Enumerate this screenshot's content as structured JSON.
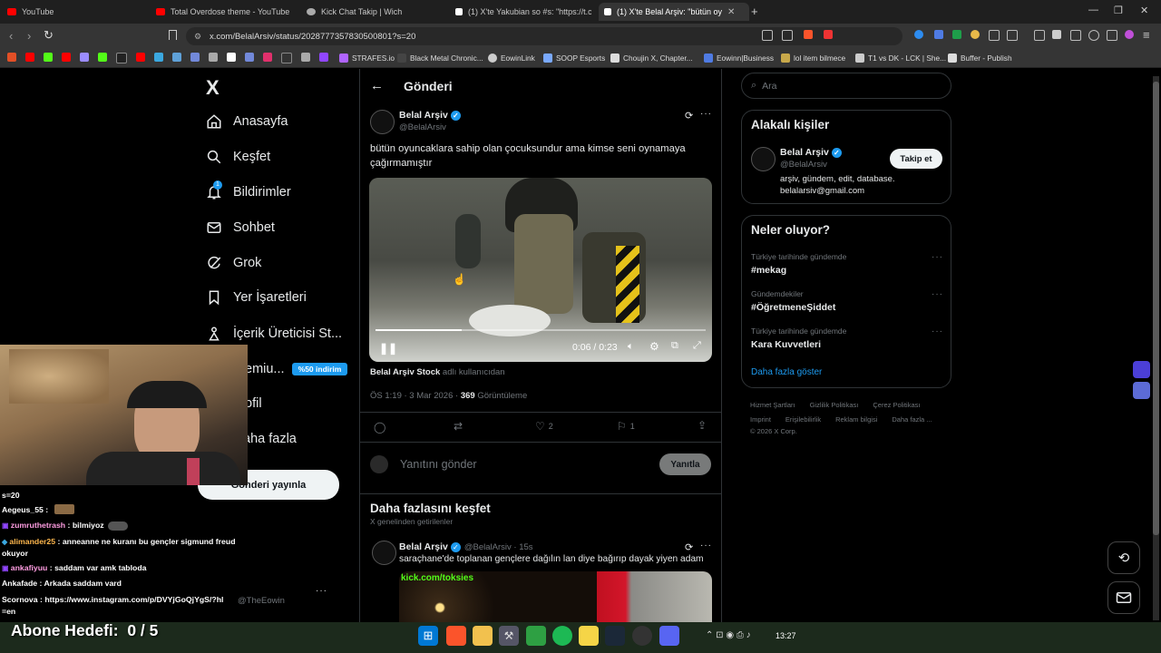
{
  "browser": {
    "tabs": [
      {
        "label": "YouTube",
        "color": "#ff0000"
      },
      {
        "label": "Total Overdose theme - YouTube",
        "color": "#ff0000"
      },
      {
        "label": "Kick Chat Takip | Wich",
        "color": "#aaaaaa"
      },
      {
        "label": "(1) X'te Yakubian so #s: \"https://t.co/",
        "color": "#ffffff"
      },
      {
        "label": "(1) X'te Belal Arşiv: \"bütün oy",
        "color": "#ffffff"
      }
    ],
    "url": "x.com/BelalArsiv/status/2028777357830500801?s=20",
    "bookmarks": [
      "STRAFES.io",
      "Black Metal Chronic...",
      "EowinLink",
      "SOOP Esports",
      "Choujin X, Chapter...",
      "Eowinn|Business",
      "lol item bilmece",
      "T1 vs DK - LCK | She...",
      "Buffer - Publish"
    ]
  },
  "sidebar": {
    "logo": "X",
    "items": [
      {
        "label": "Anasayfa",
        "icon": "home-icon"
      },
      {
        "label": "Keşfet",
        "icon": "search-icon"
      },
      {
        "label": "Bildirimler",
        "icon": "bell-icon",
        "badge": "1"
      },
      {
        "label": "Sohbet",
        "icon": "mail-icon"
      },
      {
        "label": "Grok",
        "icon": "grok-icon"
      },
      {
        "label": "Yer İşaretleri",
        "icon": "bookmark-icon"
      },
      {
        "label": "İçerik Üreticisi St...",
        "icon": "creator-icon"
      },
      {
        "label": "emiu...",
        "icon": "premium-icon"
      },
      {
        "label": "ofil",
        "icon": "profile-icon"
      },
      {
        "label": "aha fazla",
        "icon": "more-icon"
      }
    ],
    "premium_badge": "%50 indirim",
    "post_button": "Gönderi yayınla",
    "account_handle": "@TheEowin"
  },
  "post": {
    "header_title": "Gönderi",
    "author_name": "Belal Arşiv",
    "author_handle": "@BelalArsiv",
    "text": "bütün oyuncaklara sahip olan çocuksundur ama kimse seni oynamaya çağırmamıştır",
    "video": {
      "time": "0:06 / 0:23",
      "progress": 0.26
    },
    "attribution_name": "Belal Arşiv Stock",
    "attribution_suffix": "adlı kullanıcıdan",
    "time": "ÖS 1:19 · 3 Mar 2026 ·",
    "views_count": "369",
    "views_label": "Görüntüleme",
    "actions": {
      "likes": "2",
      "bookmarks": "1"
    },
    "reply_placeholder": "Yanıtını gönder",
    "reply_button": "Yanıtla"
  },
  "discover": {
    "title": "Daha fazlasını keşfet",
    "subtitle": "X genelinden getirilenler",
    "author_name": "Belal Arşiv",
    "author_meta": "@BelalArsiv · 15s",
    "text": "saraçhane'de toplanan gençlere dağılın lan diye bağırıp dayak yiyen adam",
    "image_caption": "kick.com/toksies"
  },
  "right": {
    "search_placeholder": "Ara",
    "relevant_title": "Alakalı kişiler",
    "person_name": "Belal Arşiv",
    "person_handle": "@BelalArsiv",
    "person_bio": "arşiv, gündem, edit, database. belalarsiv@gmail.com",
    "follow_button": "Takip et",
    "trends_title": "Neler oluyor?",
    "trends": [
      {
        "meta": "Türkiye tarihinde gündemde",
        "name": "#mekag"
      },
      {
        "meta": "Gündemdekiler",
        "name": "#ÖğretmeneŞiddet"
      },
      {
        "meta": "Türkiye tarihinde gündemde",
        "name": "Kara Kuvvetleri"
      }
    ],
    "show_more": "Daha fazla göster",
    "footer_row1": [
      "Hizmet Şartları",
      "Gizlilik Politikası",
      "Çerez Politikası"
    ],
    "footer_row2": [
      "Imprint",
      "Erişilebilirlik",
      "Reklam bilgisi",
      "Daha fazla ..."
    ],
    "copyright": "© 2026 X Corp."
  },
  "stream": {
    "chat_top": "s=20",
    "chat": [
      {
        "user": "Aegeus_55",
        "msg": "",
        "color": "#ffffff"
      },
      {
        "user": "zumruthetrash",
        "msg": ": bilmiyoz",
        "color": "#ff9de2"
      },
      {
        "user": "alimander25",
        "msg": ": anneanne ne kuranı bu gençler sigmund freud okuyor",
        "color": "#ffb74d"
      },
      {
        "user": "ankafiyuu",
        "msg": ": saddam var amk tabloda",
        "color": "#ff9de2"
      },
      {
        "user": "Ankafade",
        "msg": ": Arkada saddam vard",
        "color": "#ffffff"
      },
      {
        "user": "Scornova",
        "msg": ": https://www.instagram.com/p/DVYjGoQjYgS/?hl=en",
        "color": "#ffffff"
      }
    ],
    "goal": "Abone Hedefi:  0 / 5"
  },
  "taskbar": {
    "time": "13:27"
  }
}
